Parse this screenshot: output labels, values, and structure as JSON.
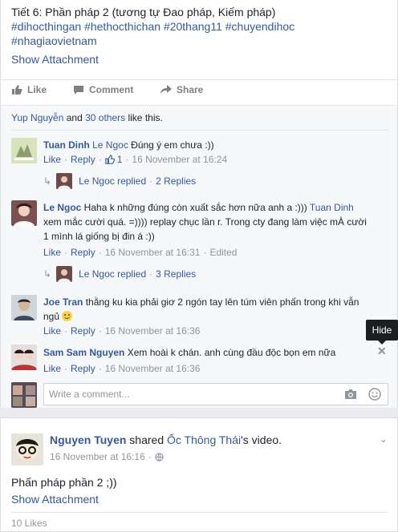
{
  "post1": {
    "text": "Tiết 6: Phần pháp 2 (tương tự Đao pháp, Kiếm pháp)",
    "hashtags_line1": "#dihocthingan #hethocthichan #20thang11 #chuyendihoc",
    "hashtags_line2": "#nhagiaovietnam",
    "show_attachment": "Show Attachment",
    "actions": {
      "like": "Like",
      "comment": "Comment",
      "share": "Share"
    },
    "likes_summary": {
      "name": "Yup Nguyễn",
      "and": " and ",
      "others": "30 others",
      "suffix": " like this."
    }
  },
  "comments": [
    {
      "author": "Tuan Dinh",
      "text_mention": "Le Ngoc",
      "text": " Đúng ý em chưa :))",
      "like": "Like",
      "reply": "Reply",
      "like_count": "1",
      "time": "16 November at 16:24",
      "replied_by": "Le Ngoc replied",
      "replies": "2 Replies"
    },
    {
      "author": "Le Ngoc",
      "text_a": " Haha k những đúng còn xuất sắc hơn nữa anh a :))) ",
      "text_mention": "Tuan Dinh",
      "text_b": " xem mắc cười quá. =)))) replay chục lần r. Trong cty đang làm việc mÀ cười 1 mình lá giống bị đin á :))",
      "like": "Like",
      "reply": "Reply",
      "time": "16 November at 16:31",
      "edited": "Edited",
      "replied_by": "Le Ngoc replied",
      "replies": "3 Replies"
    },
    {
      "author": "Joe Tran",
      "text": " thằng ku kia phải giơ 2 ngón tay lên túm viên phấn trong khi vẫn ngủ ",
      "like": "Like",
      "reply": "Reply",
      "time": "16 November at 16:36"
    },
    {
      "author": "Sam Sam Nguyen",
      "text": " Xem hoài k chán. anh cùng đầu độc bọn em nữa",
      "like": "Like",
      "reply": "Reply",
      "time": "16 November at 16:36"
    }
  ],
  "tooltip": "Hide",
  "write_comment_placeholder": "Write a comment...",
  "post2": {
    "author": "Nguyen Tuyen",
    "shared": " shared ",
    "page": "Ốc Thông Thái",
    "suffix": "'s video.",
    "time": "16 November at 16:16",
    "body": "Phấn pháp phần 2 ;))",
    "show_attachment": "Show Attachment",
    "likes": "10 Likes"
  },
  "colors": {
    "link": "#365899",
    "meta": "#90949c",
    "bg": "#e9ebee"
  }
}
